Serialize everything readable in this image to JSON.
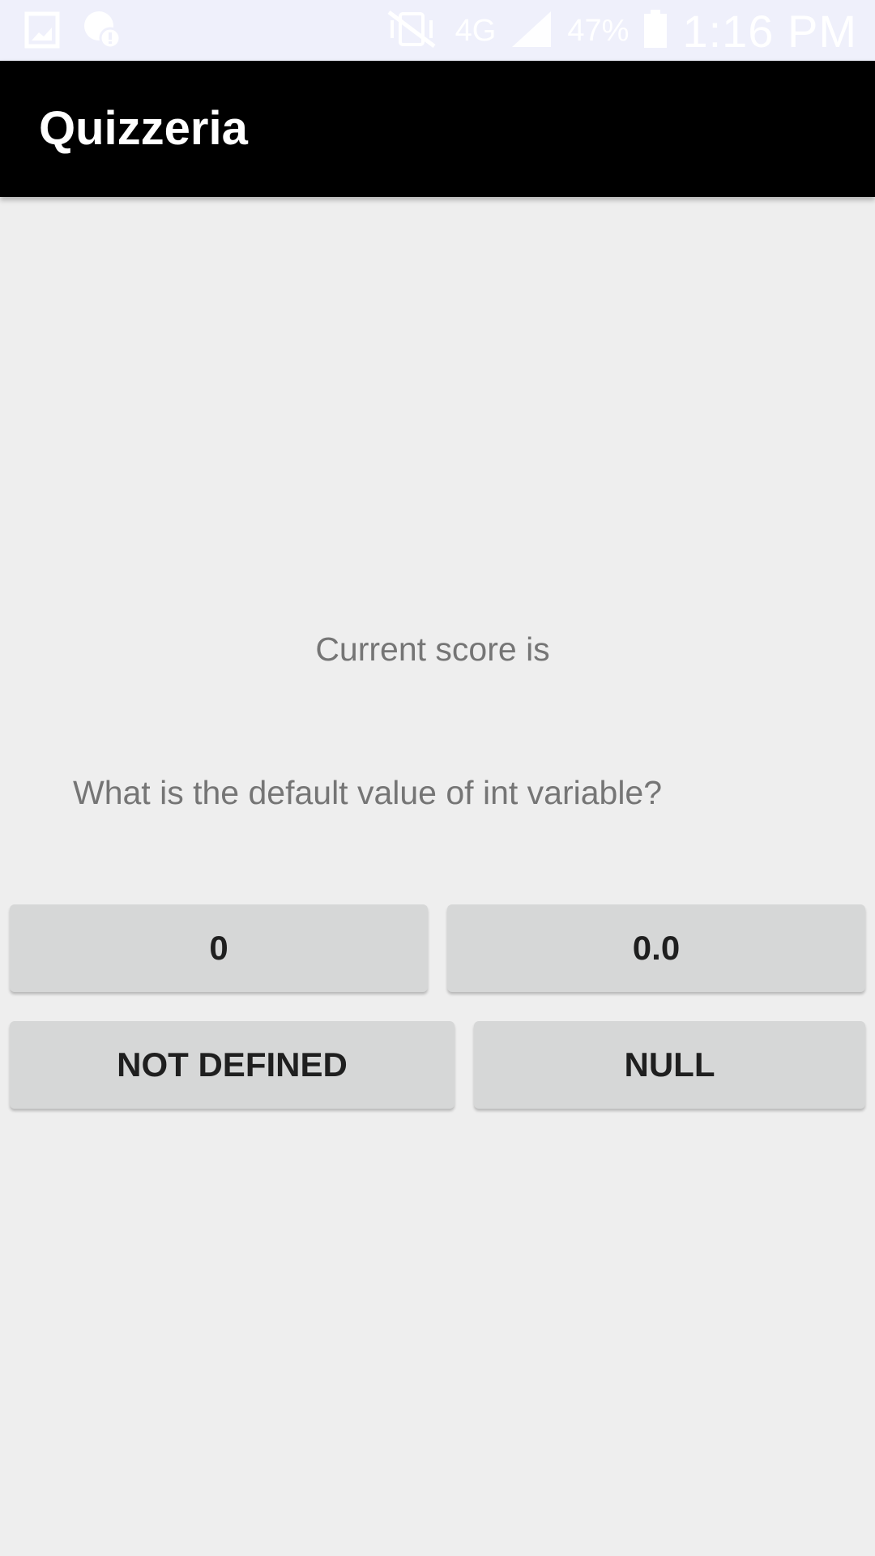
{
  "status_bar": {
    "icons_left": [
      "gallery-icon",
      "alert-badge-icon"
    ],
    "icons_right": [
      "vibrate-mute-icon",
      "cell-signal-icon",
      "battery-icon"
    ],
    "network": "4G",
    "battery_percent": "47%",
    "time": "1:16 PM"
  },
  "app_bar": {
    "title": "Quizzeria"
  },
  "quiz": {
    "score_label": "Current score is",
    "question": "What is the default value of int variable?",
    "options": [
      "0",
      "0.0",
      "NOT DEFINED",
      "NULL"
    ]
  },
  "colors": {
    "status_bar_bg": "#eff0fb",
    "app_bar_bg": "#000000",
    "page_bg": "#eeeeee",
    "button_bg": "#d6d7d7",
    "secondary_text": "#757575"
  }
}
